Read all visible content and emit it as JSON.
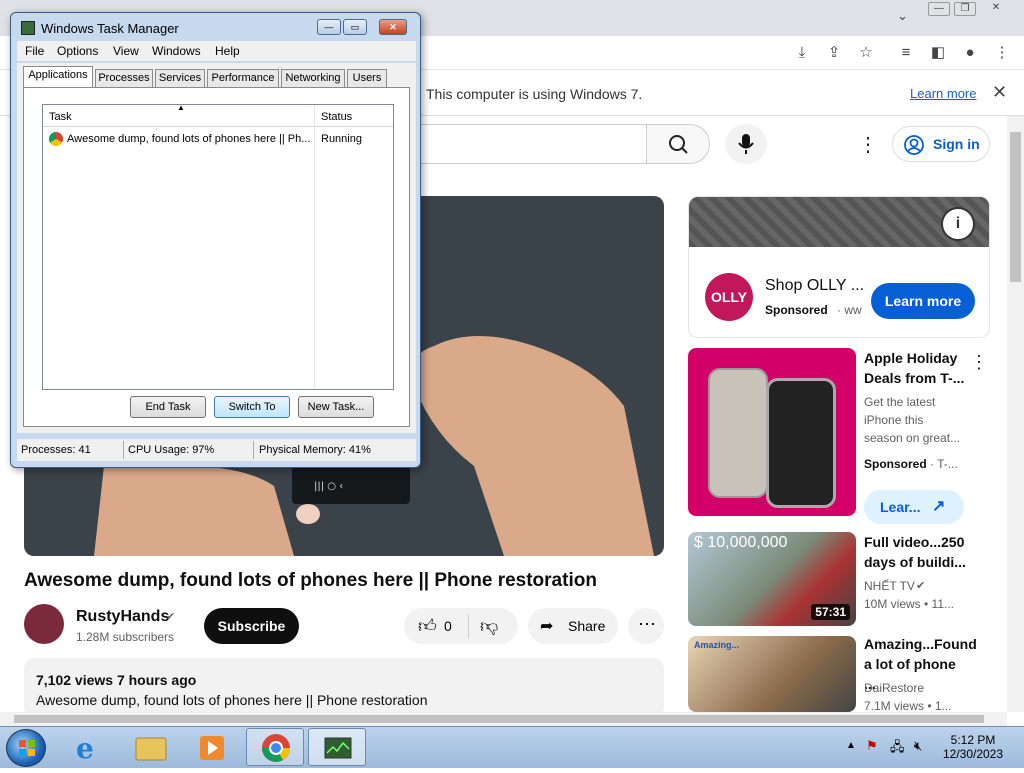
{
  "browser": {
    "infobar_text": "This computer is using Windows 7.",
    "infobar_link": "Learn more",
    "infobar_close": "✕"
  },
  "youtube": {
    "signin_label": "Sign in",
    "video_title": "Awesome dump, found lots of phones here || Phone restoration",
    "channel_name": "RustyHands",
    "subscribers": "1.28M subscribers",
    "subscribe_label": "Subscribe",
    "like_count": "0",
    "share_label": "Share",
    "views": "7,102 views  7 hours ago",
    "description": "Awesome dump, found lots of phones here || Phone restoration",
    "phone_screen_keys": "|||   ○   ‹"
  },
  "ad": {
    "logo_text": "OLLY",
    "title": "Shop OLLY ...",
    "sponsored": "Sponsored",
    "domain": "· ww",
    "learn_more": "Learn more"
  },
  "sidebar": {
    "items": [
      {
        "title_line1": "Apple Holiday",
        "title_line2": "Deals from T-...",
        "desc": [
          "Get the latest",
          "iPhone this",
          "season on great..."
        ],
        "meta": "Sponsored",
        "meta2": "· T-...",
        "cta": "Lear..."
      },
      {
        "title_line1": "Full video...250",
        "title_line2": "days of buildi...",
        "channel": "NHẾT TV",
        "meta": "10M views  • 11...",
        "duration": "57:31",
        "thumb_text": "$ 10,000,000"
      },
      {
        "title_line1": "Amazing...Found",
        "title_line2": "a lot of phone ...",
        "channel": "DaiRestore",
        "meta": "7.1M views  • 1...",
        "thumb_text": "Amazing..."
      }
    ]
  },
  "taskmanager": {
    "title": "Windows Task Manager",
    "menu": [
      "File",
      "Options",
      "View",
      "Windows",
      "Help"
    ],
    "tabs": [
      "Applications",
      "Processes",
      "Services",
      "Performance",
      "Networking",
      "Users"
    ],
    "columns": [
      "Task",
      "Status"
    ],
    "rows": [
      {
        "task": "Awesome dump, found lots of phones here || Ph...",
        "status": "Running"
      }
    ],
    "buttons": [
      "End Task",
      "Switch To",
      "New Task..."
    ],
    "status": {
      "processes": "Processes: 41",
      "cpu": "CPU Usage: 97%",
      "memory": "Physical Memory: 41%"
    }
  },
  "taskbar": {
    "time": "5:12 PM",
    "date": "12/30/2023"
  }
}
